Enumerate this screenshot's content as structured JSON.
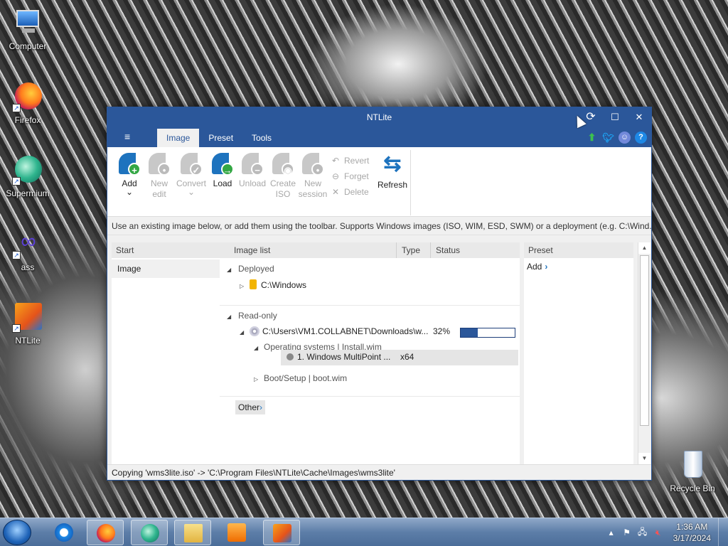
{
  "desktop": {
    "icons": [
      {
        "label": "Computer"
      },
      {
        "label": "Firefox"
      },
      {
        "label": "Supermium"
      },
      {
        "label": "ass"
      },
      {
        "label": "NTLite"
      },
      {
        "label": "Recycle Bin"
      }
    ]
  },
  "window": {
    "title": "NTLite",
    "controls": {
      "minimize": "—",
      "maximize": "☐",
      "close": "✕"
    },
    "menu_icon": "≡",
    "tabs": [
      {
        "label": "Image",
        "active": true
      },
      {
        "label": "Preset",
        "active": false
      },
      {
        "label": "Tools",
        "active": false
      }
    ],
    "social_icons": [
      "update-arrow-icon",
      "twitter-icon",
      "discord-icon",
      "help-icon"
    ],
    "help_glyph": "?",
    "toolbar": {
      "add": {
        "label": "Add",
        "dropdown": "⌄"
      },
      "new_edit": {
        "line1": "New",
        "line2": "edit"
      },
      "convert": {
        "label": "Convert",
        "dropdown": "⌄"
      },
      "load": {
        "label": "Load"
      },
      "unload": {
        "label": "Unload"
      },
      "create_iso": {
        "line1": "Create",
        "line2": "ISO"
      },
      "new_session": {
        "line1": "New",
        "line2": "session"
      },
      "revert": {
        "label": "Revert"
      },
      "forget": {
        "label": "Forget"
      },
      "delete": {
        "label": "Delete"
      },
      "refresh": {
        "label": "Refresh"
      }
    },
    "hint": "Use an existing image below, or add them using the toolbar. Supports Windows images (ISO, WIM, ESD, SWM) or a deployment (e.g. C:\\Wind...",
    "start_pane": {
      "header": "Start",
      "items": [
        "Image"
      ]
    },
    "image_pane": {
      "columns": {
        "list": "Image list",
        "type": "Type",
        "status": "Status"
      },
      "groups": {
        "deployed": {
          "label": "Deployed",
          "items": [
            {
              "path": "C:\\Windows"
            }
          ]
        },
        "read_only": {
          "label": "Read-only",
          "iso_path": "C:\\Users\\VM1.COLLABNET\\Downloads\\w...",
          "progress_text": "32%",
          "progress": 0.32,
          "os_node": "Operating systems  |  Install.wim",
          "edition": "1. Windows MultiPoint ...",
          "edition_type": "x64",
          "boot_node": "Boot/Setup  |  boot.wim"
        }
      },
      "other_button": "Other"
    },
    "preset_pane": {
      "header": "Preset",
      "add_label": "Add"
    },
    "status": "Copying 'wms3lite.iso' -> 'C:\\Program Files\\NTLite\\Cache\\Images\\wms3lite'"
  },
  "taskbar": {
    "clock_time": "1:36 AM",
    "clock_date": "3/17/2024",
    "apps": [
      "ie-icon",
      "firefox-icon",
      "supermium-icon",
      "explorer-icon",
      "media-player-icon",
      "ntlite-icon"
    ]
  }
}
